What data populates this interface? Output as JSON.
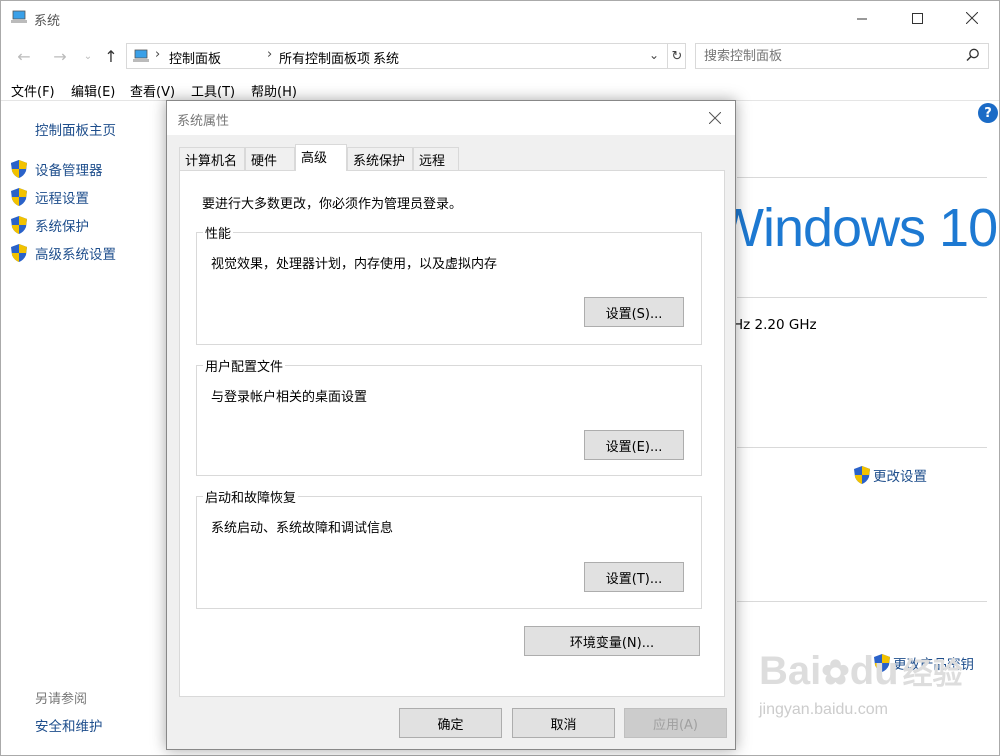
{
  "window": {
    "title": "系统"
  },
  "address": {
    "crumbs": [
      "控制面板",
      "所有控制面板项",
      "系统"
    ]
  },
  "search": {
    "placeholder": "搜索控制面板"
  },
  "menu": [
    "文件(F)",
    "编辑(E)",
    "查看(V)",
    "工具(T)",
    "帮助(H)"
  ],
  "nav": {
    "home": "控制面板主页",
    "items": [
      "设备管理器",
      "远程设置",
      "系统保护",
      "高级系统设置"
    ],
    "see_also": "另请参阅",
    "see_also_link": "安全和维护"
  },
  "background": {
    "help": "?",
    "edition_logo": "Windows 10",
    "cpu_speed": "Hz  2.20 GHz",
    "change_settings": "更改设置",
    "change_key": "更改产品密钥"
  },
  "watermark": {
    "line1": "Bai",
    "line1b": "du",
    "line1c": "经验",
    "line2": "jingyan.baidu.com"
  },
  "dialog": {
    "title": "系统属性",
    "close": "×",
    "tabs": [
      "计算机名",
      "硬件",
      "高级",
      "系统保护",
      "远程"
    ],
    "active_tab": "高级",
    "admin_note": "要进行大多数更改，你必须作为管理员登录。",
    "groups": [
      {
        "title": "性能",
        "desc": "视觉效果，处理器计划，内存使用，以及虚拟内存",
        "button": "设置(S)..."
      },
      {
        "title": "用户配置文件",
        "desc": "与登录帐户相关的桌面设置",
        "button": "设置(E)..."
      },
      {
        "title": "启动和故障恢复",
        "desc": "系统启动、系统故障和调试信息",
        "button": "设置(T)..."
      }
    ],
    "env_button": "环境变量(N)...",
    "ok": "确定",
    "cancel": "取消",
    "apply": "应用(A)"
  },
  "colors": {
    "link": "#1e4e8c",
    "win10_blue": "#1d79d2",
    "help_blue": "#1b6bc6"
  }
}
